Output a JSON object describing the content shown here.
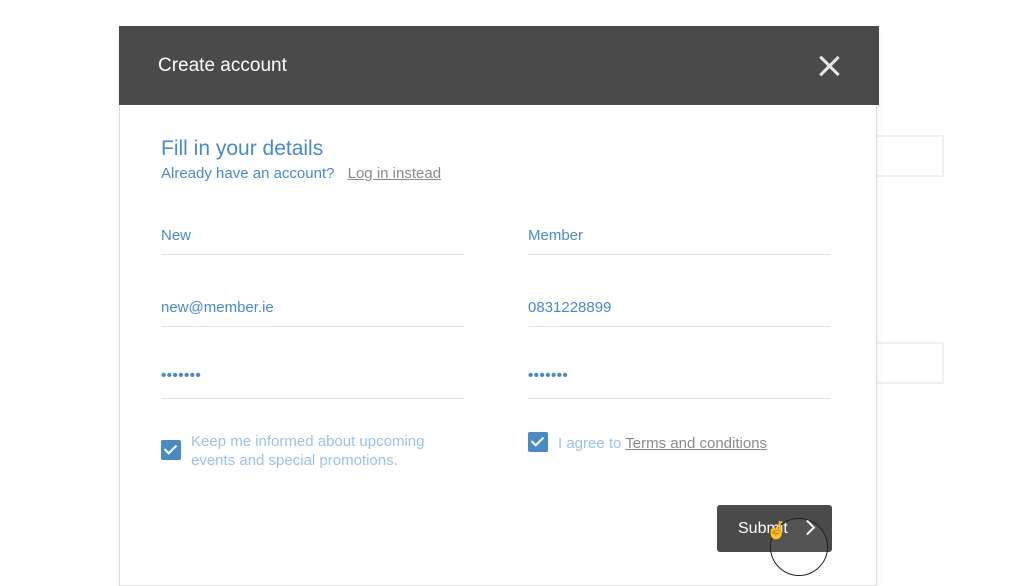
{
  "modal": {
    "title": "Create account",
    "heading": "Fill in your details",
    "login_prompt": "Already have an account?",
    "login_link": "Log in instead",
    "fields": {
      "first_name": "New",
      "last_name": "Member",
      "email": "new@member.ie",
      "phone": "0831228899",
      "password": "•••••••",
      "confirm_password": "•••••••"
    },
    "newsletter_checked": true,
    "newsletter_line1": "Keep me informed about upcoming",
    "newsletter_line2": "events and special promotions.",
    "terms_checked": true,
    "terms_prefix": "I agree to",
    "terms_link": "Terms and conditions",
    "submit_label": "Submit"
  },
  "colors": {
    "header_bg": "#4a4a4a",
    "accent": "#4a8bc4",
    "accent_light": "#9cc2e3",
    "submit_bg": "#4a4a4a"
  },
  "icons": {
    "close": "close-icon",
    "checkbox": "checkmark-icon",
    "submit_arrow": "chevron-right-icon",
    "pointer": "hand-pointer-icon"
  }
}
